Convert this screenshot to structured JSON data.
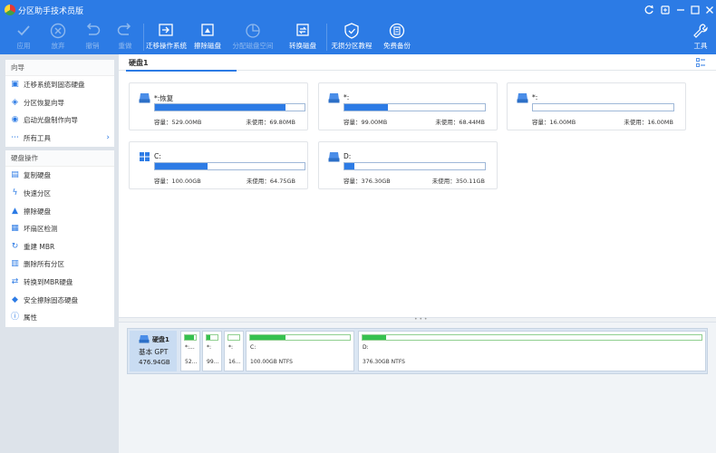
{
  "window": {
    "title": "分区助手技术员版",
    "controls": [
      "refresh-icon",
      "restore-icon",
      "minimize-icon",
      "maximize-icon",
      "close-icon"
    ]
  },
  "toolbar": {
    "buttons": [
      {
        "label": "应用",
        "icon": "check-icon",
        "enabled": false
      },
      {
        "label": "放弃",
        "icon": "cancel-icon",
        "enabled": false
      },
      {
        "label": "撤销",
        "icon": "undo-icon",
        "enabled": false
      },
      {
        "label": "重做",
        "icon": "redo-icon",
        "enabled": false
      },
      {
        "label": "迁移操作系统",
        "icon": "migrate-os-icon",
        "enabled": true
      },
      {
        "label": "擦除磁盘",
        "icon": "wipe-disk-icon",
        "enabled": true
      },
      {
        "label": "分配磁盘空间",
        "icon": "allocate-space-icon",
        "enabled": false
      },
      {
        "label": "转换磁盘",
        "icon": "convert-disk-icon",
        "enabled": true
      },
      {
        "label": "无损分区教程",
        "icon": "shield-icon",
        "enabled": true
      },
      {
        "label": "免费备份",
        "icon": "backup-icon",
        "enabled": true
      }
    ],
    "tools_label": "工具"
  },
  "sidebar": {
    "wizard": {
      "title": "向导",
      "items": [
        {
          "label": "迁移系统到固态硬盘",
          "icon": "migrate-icon"
        },
        {
          "label": "分区恢复向导",
          "icon": "recovery-icon"
        },
        {
          "label": "启动光盘制作向导",
          "icon": "bootable-media-icon"
        },
        {
          "label": "所有工具",
          "icon": "all-tools-icon"
        }
      ]
    },
    "disk_ops": {
      "title": "硬盘操作",
      "items": [
        {
          "label": "复制硬盘",
          "icon": "copy-disk-icon"
        },
        {
          "label": "快速分区",
          "icon": "lightning-icon"
        },
        {
          "label": "擦除硬盘",
          "icon": "wipe-icon"
        },
        {
          "label": "坏扇区检测",
          "icon": "bad-sector-icon"
        },
        {
          "label": "重建 MBR",
          "icon": "rebuild-mbr-icon"
        },
        {
          "label": "删除所有分区",
          "icon": "trash-icon"
        },
        {
          "label": "转换到MBR硬盘",
          "icon": "convert-mbr-icon"
        },
        {
          "label": "安全擦除固态硬盘",
          "icon": "secure-erase-icon"
        },
        {
          "label": "属性",
          "icon": "info-icon"
        }
      ]
    }
  },
  "main": {
    "disk_title": "硬盘1",
    "partitions": [
      {
        "name": "*:恢复",
        "capacity": "容量：529.00MB",
        "unused": "未使用：69.80MB",
        "fill": 0.87,
        "icon": "drive-icon"
      },
      {
        "name": "*:",
        "capacity": "容量：99.00MB",
        "unused": "未使用：68.44MB",
        "fill": 0.31,
        "icon": "drive-icon"
      },
      {
        "name": "*:",
        "capacity": "容量：16.00MB",
        "unused": "未使用：16.00MB",
        "fill": 0.0,
        "icon": "drive-icon"
      },
      {
        "name": "C:",
        "capacity": "容量：100.00GB",
        "unused": "未使用：64.75GB",
        "fill": 0.35,
        "icon": "windows-icon"
      },
      {
        "name": "D:",
        "capacity": "容量：376.30GB",
        "unused": "未使用：350.11GB",
        "fill": 0.07,
        "icon": "drive-icon"
      }
    ]
  },
  "diskmap": {
    "name": "硬盘1",
    "type": "基本 GPT",
    "size": "476.94GB",
    "partitions": [
      {
        "label": "*:...",
        "info": "52...",
        "fill": 0.87
      },
      {
        "label": "*:",
        "info": "99...",
        "fill": 0.31
      },
      {
        "label": "*:",
        "info": "16...",
        "fill": 0.0
      },
      {
        "label": "C:",
        "info": "100.00GB NTFS",
        "fill": 0.35
      },
      {
        "label": "D:",
        "info": "376.30GB NTFS",
        "fill": 0.07
      }
    ]
  },
  "colors": {
    "accent": "#2c7be5",
    "used_bar": "#2c7be5",
    "partition_bar": "#36c14f"
  }
}
